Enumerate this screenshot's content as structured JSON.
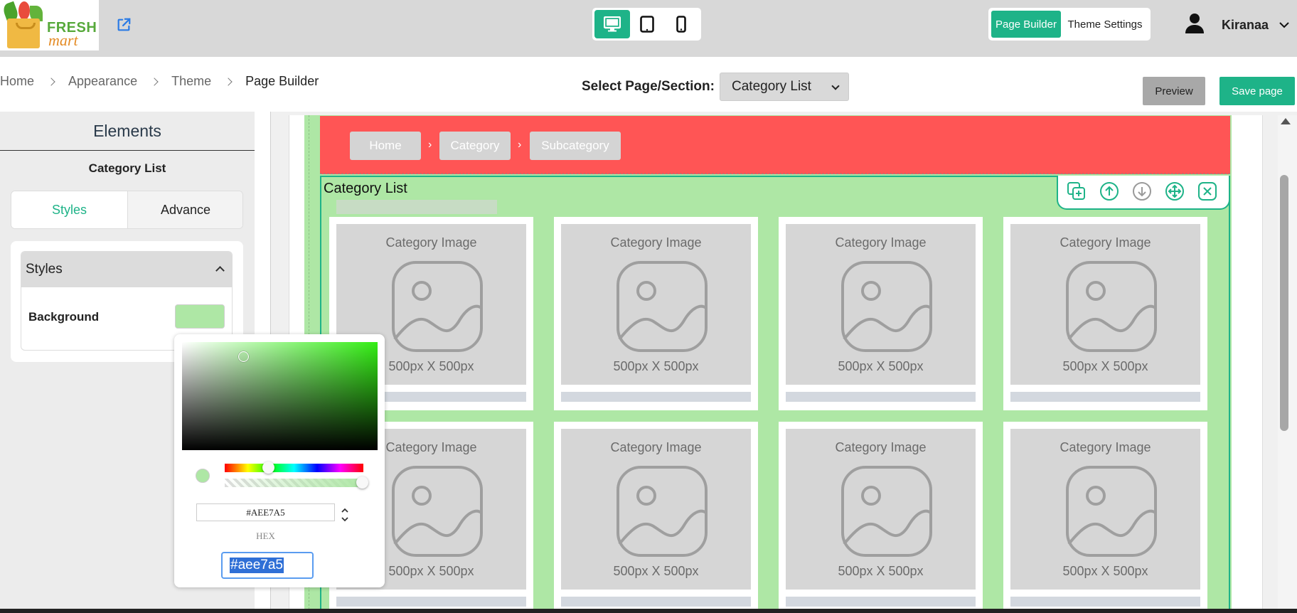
{
  "brand": {
    "line1": "FRESH",
    "line2": "mart"
  },
  "header": {
    "mode_tabs": [
      "Page Builder",
      "Theme Settings"
    ],
    "user_name": "Kiranaa"
  },
  "breadcrumb": [
    "Home",
    "Appearance",
    "Theme",
    "Page Builder"
  ],
  "page_select": {
    "label": "Select Page/Section:",
    "value": "Category List"
  },
  "actions": {
    "preview": "Preview",
    "save": "Save page"
  },
  "left_panel": {
    "title": "Elements",
    "subtitle": "Category List",
    "tabs": [
      "Styles",
      "Advance"
    ],
    "accordion_title": "Styles",
    "background_label": "Background"
  },
  "color_picker": {
    "hex_display": "#AEE7A5",
    "hex_label": "HEX",
    "hex_edit_value": "#aee7a5",
    "current_color": "#aee7a5"
  },
  "canvas": {
    "breadcrumb_chips": [
      "Home",
      "Category",
      "Subcategory"
    ],
    "section_title": "Category List",
    "cards": [
      {
        "label": "Category Image",
        "size": "500px X 500px"
      },
      {
        "label": "Category Image",
        "size": "500px X 500px"
      },
      {
        "label": "Category Image",
        "size": "500px X 500px"
      },
      {
        "label": "Category Image",
        "size": "500px X 500px"
      },
      {
        "label": "Category Image",
        "size": "500px X 500px"
      },
      {
        "label": "Category Image",
        "size": "500px X 500px"
      },
      {
        "label": "Category Image",
        "size": "500px X 500px"
      },
      {
        "label": "Category Image",
        "size": "500px X 500px"
      }
    ],
    "toolbar_icons": [
      "duplicate-icon",
      "move-up-icon",
      "move-down-icon",
      "drag-move-icon",
      "close-icon"
    ]
  },
  "colors": {
    "accent": "#1eb388",
    "section_background": "#aee7a5",
    "header_section": "#ff5555"
  }
}
